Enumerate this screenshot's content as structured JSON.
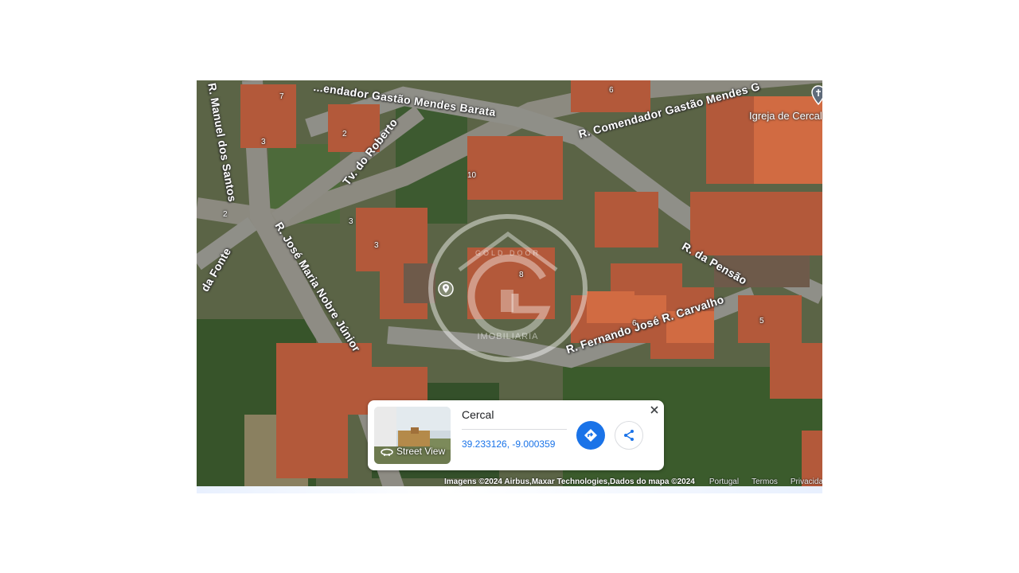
{
  "map": {
    "streets": [
      "R. Manuel dos Santos",
      "...endador Gastão Mendes Barata",
      "R. Comendador Gastão Mendes G",
      "Tv. do Roberto",
      "R. José Maria Nobre Júnior",
      "R. da Pensão",
      "R. Fernando José R. Carvalho",
      "da Fonte"
    ],
    "house_numbers": [
      "7",
      "3",
      "2",
      "6",
      "10",
      "3",
      "3",
      "2",
      "8",
      "6",
      "5"
    ],
    "poi": {
      "label": "Igreja de Cercal",
      "icon": "church-pin-icon"
    },
    "watermark": {
      "text_top": "GOLD DOOR",
      "text_bottom": "IMOBILIARIA",
      "letter": "G"
    }
  },
  "info_card": {
    "street_view_label": "Street View",
    "place_name": "Cercal",
    "coordinates": "39.233126, -9.000359",
    "directions_icon": "directions-icon",
    "share_icon": "share-icon",
    "close_icon": "close-icon"
  },
  "attribution": {
    "source": "Imagens ©2024 Airbus,Maxar Technologies,Dados do mapa ©2024",
    "links": [
      "Portugal",
      "Termos",
      "Privacidade"
    ]
  },
  "colors": {
    "accent": "#1a73e8",
    "roof": "#c8623e",
    "vegetation": "#3f5a2a",
    "road": "#8f8f88"
  }
}
